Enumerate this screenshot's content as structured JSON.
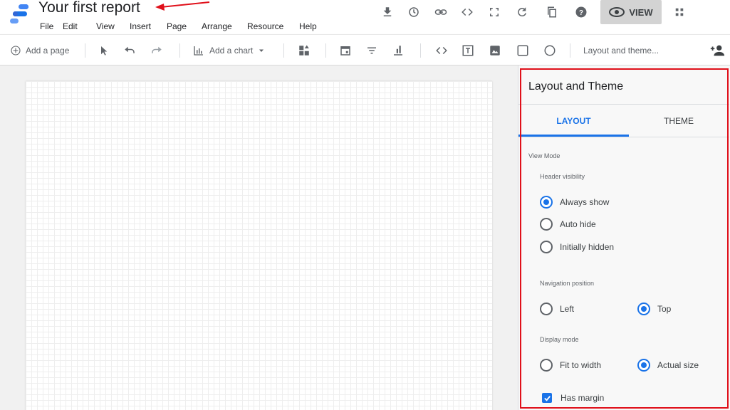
{
  "header": {
    "title": "Your first report",
    "menu": [
      "File",
      "Edit",
      "View",
      "Insert",
      "Page",
      "Arrange",
      "Resource",
      "Help"
    ],
    "icons": [
      "download-icon",
      "history-icon",
      "link-icon",
      "embed-code-icon",
      "fullscreen-icon",
      "refresh-icon",
      "duplicate-icon",
      "help-icon"
    ],
    "view_label": "VIEW",
    "annotation_color": "#e0101a"
  },
  "toolbar": {
    "add_page_label": "Add a page",
    "add_chart_label": "Add a chart",
    "theme_label": "Layout and theme...",
    "icons": [
      "add-circle-icon",
      "pointer-icon",
      "undo-icon",
      "redo-icon",
      "bar-chart-icon",
      "community-viz-icon",
      "date-range-icon",
      "filter-control-icon",
      "data-control-icon",
      "url-embed-icon",
      "text-icon",
      "image-icon",
      "rectangle-icon",
      "circle-icon",
      "add-person-icon"
    ]
  },
  "panel": {
    "title": "Layout and Theme",
    "tabs": {
      "layout": "LAYOUT",
      "theme": "THEME",
      "active": "LAYOUT"
    },
    "view_mode_label": "View Mode",
    "header_visibility": {
      "label": "Header visibility",
      "options": [
        "Always show",
        "Auto hide",
        "Initially hidden"
      ],
      "selected": "Always show"
    },
    "navigation_position": {
      "label": "Navigation position",
      "options": [
        "Left",
        "Top"
      ],
      "selected": "Top"
    },
    "display_mode": {
      "label": "Display mode",
      "options": [
        "Fit to width",
        "Actual size"
      ],
      "selected": "Actual size"
    },
    "has_margin": {
      "label": "Has margin",
      "checked": true
    },
    "accent_color": "#1a73e8"
  }
}
